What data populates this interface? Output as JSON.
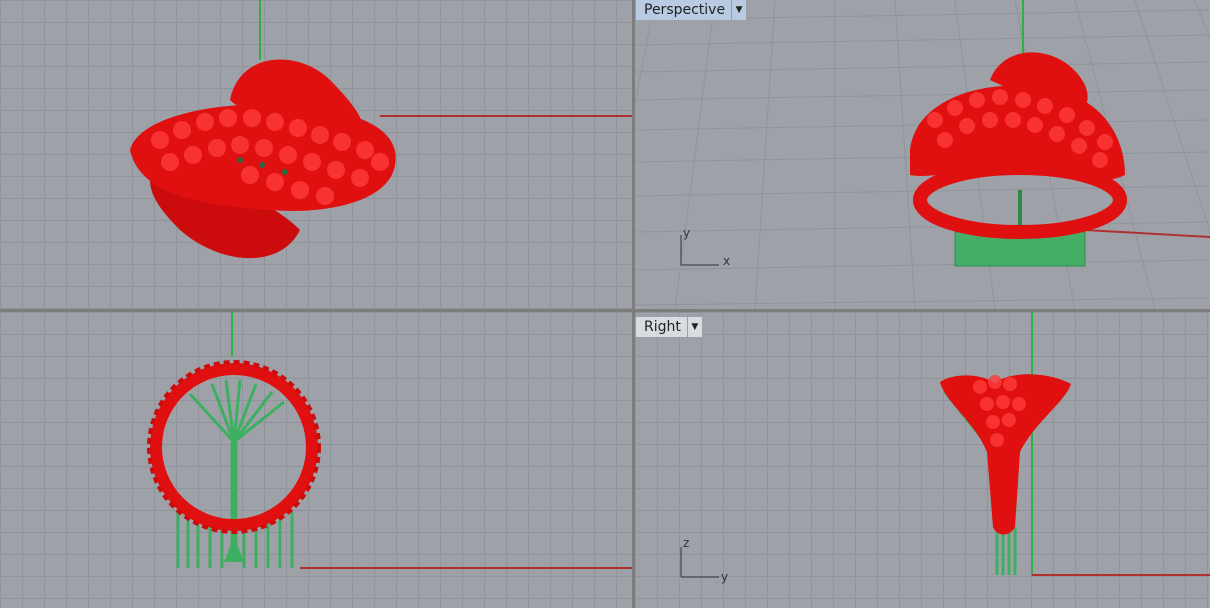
{
  "viewports": {
    "top": {
      "label": ""
    },
    "perspective": {
      "label": "Perspective",
      "axis_x": "x",
      "axis_y": "y"
    },
    "front": {
      "label": ""
    },
    "right": {
      "label": "Right",
      "axis_x": "y",
      "axis_y": "z"
    }
  },
  "icons": {
    "dropdown": "chevron-down-icon"
  },
  "colors": {
    "model_red": "#e01010",
    "support_green": "#3cb060",
    "axis_red": "#b03030",
    "axis_green": "#30b040",
    "viewport_bg": "#9ea2a8",
    "label_active": "#b9cbe3"
  }
}
